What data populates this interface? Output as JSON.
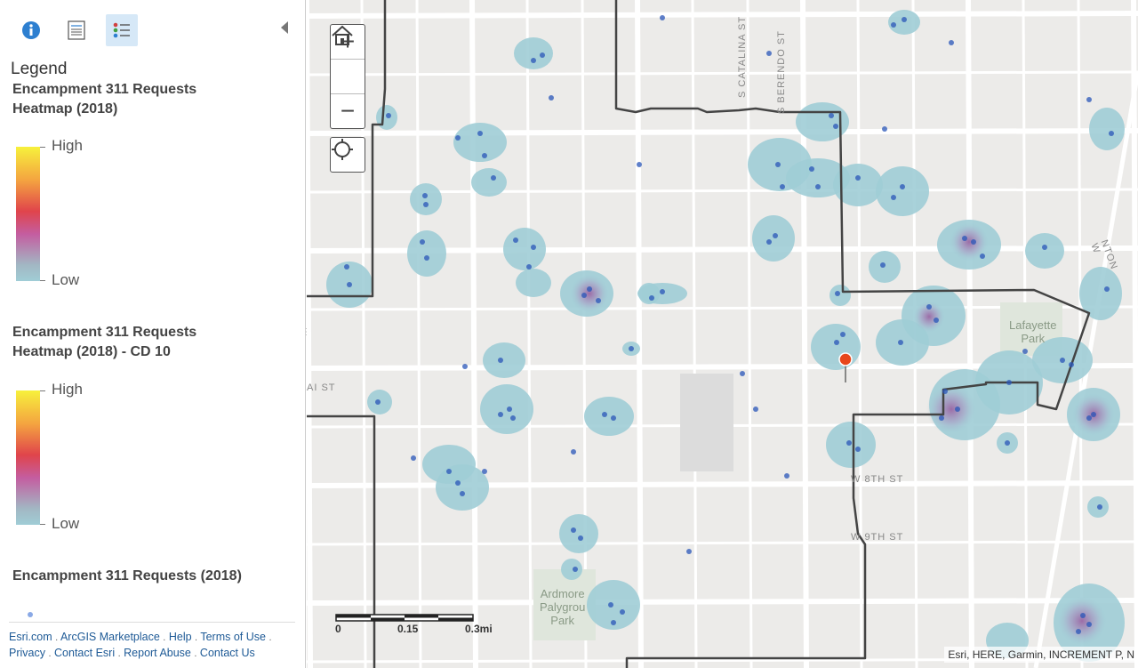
{
  "toolbar": {
    "about_icon": "info-icon",
    "content_icon": "content-list-icon",
    "legend_icon": "legend-icon"
  },
  "legend": {
    "title": "Legend",
    "layers": [
      {
        "title_line1": "Encampment 311 Requests",
        "title_line2": "Heatmap (2018)",
        "high": "High",
        "low": "Low"
      },
      {
        "title_line1": "Encampment 311 Requests",
        "title_line2": "Heatmap (2018) - CD 10",
        "high": "High",
        "low": "Low"
      },
      {
        "title_line1": "Encampment 311 Requests (2018)"
      }
    ]
  },
  "footer": {
    "links": [
      "Esri.com",
      "ArcGIS Marketplace",
      "Help",
      "Terms of Use",
      "Privacy",
      "Contact Esri",
      "Report Abuse",
      "Contact Us"
    ]
  },
  "map": {
    "zoom_in": "+",
    "zoom_out": "−",
    "home_icon": "home-icon",
    "locate_icon": "locate-icon",
    "scale": {
      "l0": "0",
      "l1": "0.15",
      "l2": "0.3mi"
    },
    "attribution": "Esri, HERE, Garmin, INCREMENT P, N",
    "streets": {
      "catalina": "S CATALINA ST",
      "berendo": "S BERENDO ST",
      "w8th": "W 8TH ST",
      "w9th": "W 9TH ST",
      "st": "AI ST",
      "hilton": "NTON W"
    },
    "parks": {
      "lafayette_1": "Lafayette",
      "lafayette_2": "Park",
      "ardmore_1": "Ardmore",
      "ardmore_2": "Palygrou",
      "ardmore_3": "Park"
    }
  },
  "colors": {
    "heat_low": "#a0cdd6",
    "point": "#2a56b8",
    "boundary": "#444444",
    "accent": "#1e5a96"
  }
}
